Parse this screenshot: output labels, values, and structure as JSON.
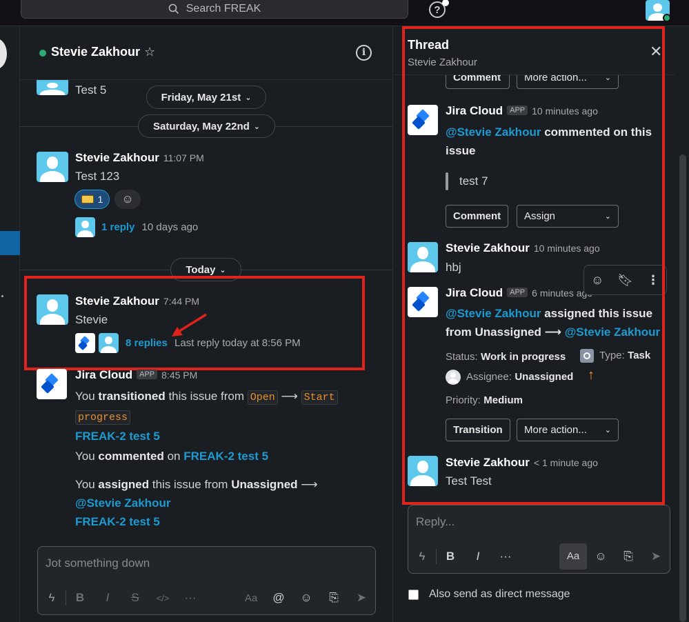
{
  "search": {
    "placeholder": "Search FREAK"
  },
  "topbar": {
    "help_label": "?"
  },
  "channel": {
    "title": "Stevie Zakhour",
    "star": "☆",
    "info": "i",
    "messages": {
      "first": {
        "text": "Test 5"
      },
      "dates": [
        "Friday, May 21st",
        "Saturday, May 22nd",
        "Today"
      ],
      "msg1": {
        "name": "Stevie Zakhour",
        "time": "11:07 PM",
        "text": "Test 123",
        "reaction_count": "1",
        "reply_count": "1 reply",
        "reply_ago": "10 days ago"
      },
      "msg2": {
        "name": "Stevie Zakhour",
        "time": "7:44 PM",
        "text": "Stevie",
        "replies": "8 replies",
        "last_reply": "Last reply today at 8:56 PM"
      },
      "msg3": {
        "name": "Jira Cloud",
        "badge": "APP",
        "time": "8:45 PM",
        "line1_a": "You",
        "line1_b": "transitioned",
        "line1_c": "this issue from",
        "from_state": "Open",
        "arrow": "⟶",
        "to_state_1": "Start",
        "to_state_2": "progress",
        "issue_link": "FREAK-2 test 5",
        "line2_a": "You",
        "line2_b": "commented",
        "line2_c": "on",
        "line3_a": "You",
        "line3_b": "assigned",
        "line3_c": "this issue from",
        "line3_d": "Unassigned",
        "mention": "@Stevie Zakhour"
      }
    },
    "composer": {
      "placeholder": "Jot something down"
    }
  },
  "thread": {
    "title": "Thread",
    "subtitle": "Stevie Zakhour",
    "close": "✕",
    "partial_buttons": {
      "comment": "Comment",
      "more": "More action..."
    },
    "jira1": {
      "name": "Jira Cloud",
      "badge": "APP",
      "time": "10 minutes ago",
      "mention": "@Stevie Zakhour",
      "text_a": "commented on this",
      "text_b": "issue",
      "quote": "test 7",
      "btn_comment": "Comment",
      "btn_assign": "Assign"
    },
    "stevie1": {
      "name": "Stevie Zakhour",
      "time": "10 minutes ago",
      "text": "hbj"
    },
    "jira2": {
      "name": "Jira Cloud",
      "badge": "APP",
      "time": "6 minutes ago",
      "mention": "@Stevie Zakhour",
      "text_a": "assigned this issue",
      "from": "from Unassigned",
      "arrow": "⟶",
      "mention2": "@Stevie Zakhour",
      "status_label": "Status:",
      "status_value": "Work in progress",
      "type_label": "Type:",
      "type_value": "Task",
      "assignee_label": "Assignee:",
      "assignee_value": "Unassigned",
      "priority_label": "Priority:",
      "priority_value": "Medium",
      "btn_transition": "Transition",
      "btn_more": "More action..."
    },
    "stevie2": {
      "name": "Stevie Zakhour",
      "time": "< 1 minute ago",
      "text": "Test Test"
    },
    "reply": {
      "placeholder": "Reply...",
      "aa_label": "Aa"
    },
    "also_send": "Also send as direct message"
  },
  "colors": {
    "accent": "#1d9bd1",
    "highlight_box": "#e0231c",
    "online": "#2bac76",
    "code_text": "#e8912d"
  }
}
